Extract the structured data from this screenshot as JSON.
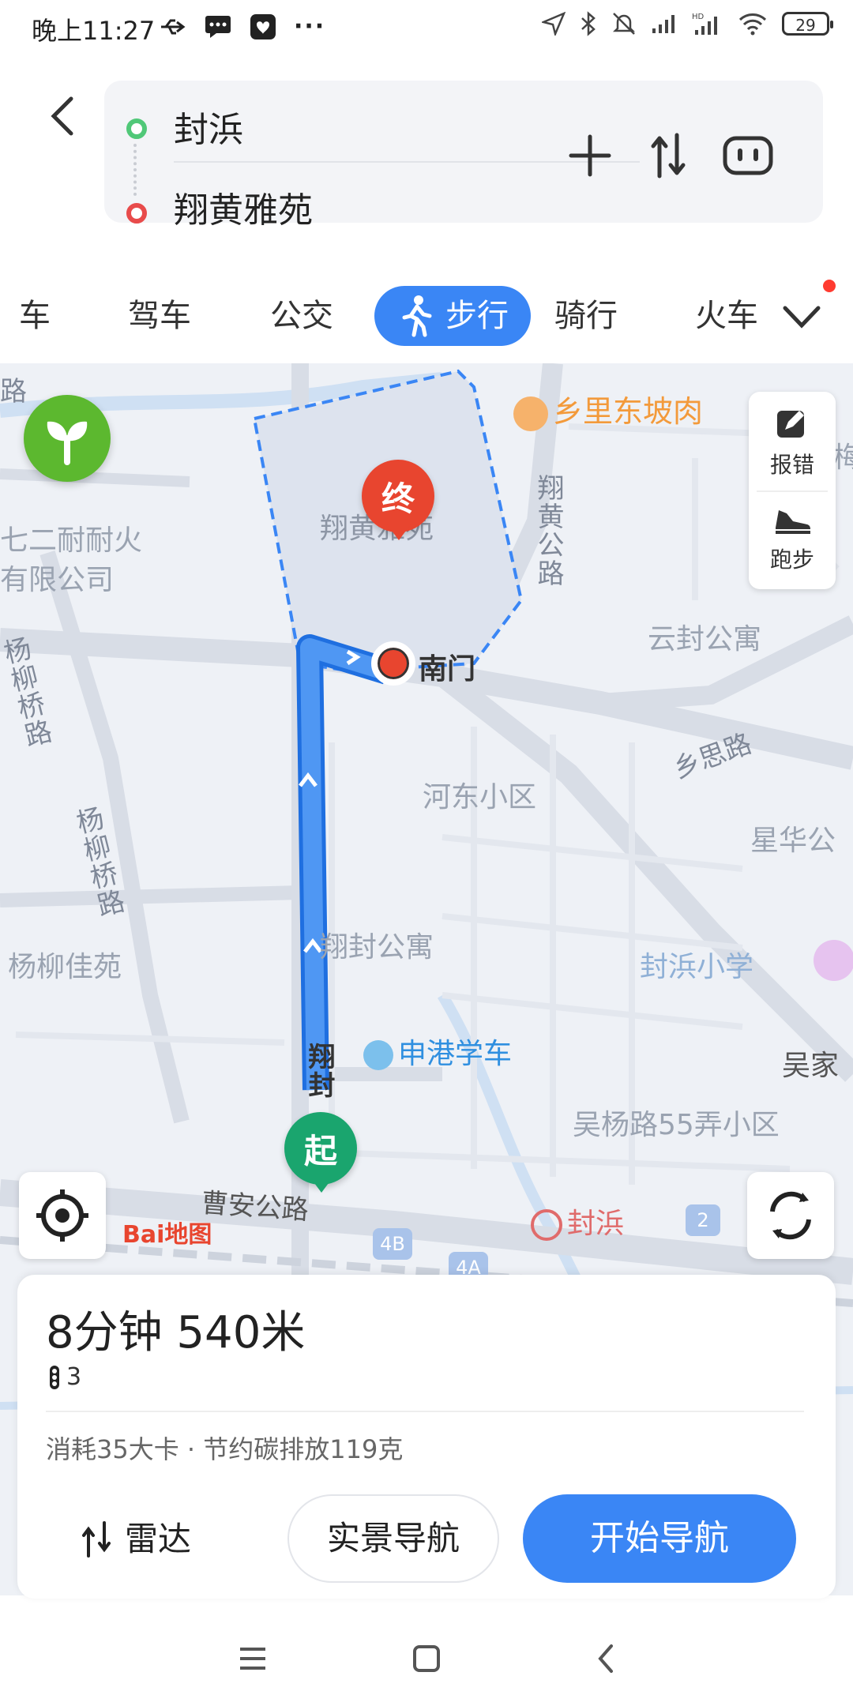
{
  "status_bar": {
    "time": "晚上11:27",
    "battery": "29"
  },
  "route": {
    "start": "封浜",
    "end": "翔黄雅苑"
  },
  "modes": {
    "tabs": [
      "车",
      "驾车",
      "公交",
      "步行",
      "骑行",
      "火车"
    ],
    "active": "步行"
  },
  "map": {
    "labels": {
      "road_yangliuqiao_1": "杨柳桥路",
      "road_yangliuqiao_2": "杨柳桥路",
      "road_xianghuang": "翔黄公路",
      "road_xiangsi": "乡思路",
      "road_caoan": "曹安公路",
      "road_xiangfeng": "翔封",
      "road_lu_top": "路",
      "poi_xiangli": "乡里东坡肉",
      "poi_company_1": "七二耐耐火",
      "poi_company_2": "有限公司",
      "poi_xianghuangyayuan": "翔黄雅苑",
      "poi_yunfeng": "云封公寓",
      "poi_hedong": "河东小区",
      "poi_xinghua": "星华公",
      "poi_yangliu": "杨柳佳苑",
      "poi_xiangfeng_apt": "翔封公寓",
      "poi_fengbang_school": "封浜小学",
      "poi_shengang": "申港学车",
      "poi_wujia": "吴家",
      "poi_wuyang": "吴杨路55弄小区",
      "poi_metro_fengbang": "封浜",
      "poi_edge_mei": "梅",
      "gate": "南门",
      "metro_exit_4b": "4B",
      "metro_exit_4a": "4A",
      "metro_exit_2": "2",
      "pin_end": "终",
      "pin_start": "起",
      "baidu_logo": "Bai地图",
      "lu_left": "路"
    },
    "tools": {
      "report": "报错",
      "run": "跑步"
    }
  },
  "summary": {
    "eta": "8分钟  540米",
    "traffic_lights": "3",
    "stats": "消耗35大卡  ·  节约碳排放119克",
    "radar": "雷达",
    "ar_nav": "实景导航",
    "start_nav": "开始导航"
  },
  "colors": {
    "accent": "#3a86f5",
    "route": "#3a86f5",
    "start_pin": "#1aa56e",
    "end_pin": "#e8452f"
  }
}
